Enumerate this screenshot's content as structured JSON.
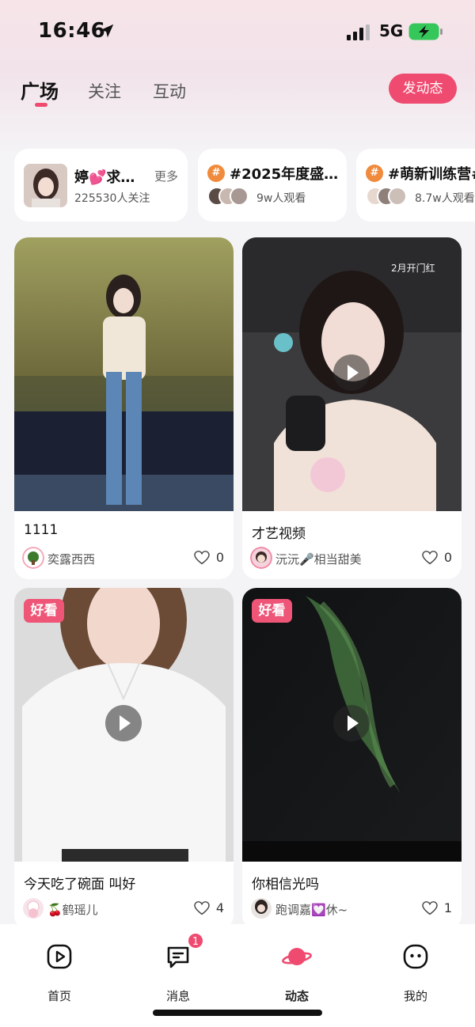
{
  "status_bar": {
    "time": "16:46",
    "network": "5G"
  },
  "header": {
    "tabs": [
      {
        "label": "广场",
        "active": true
      },
      {
        "label": "关注",
        "active": false
      },
      {
        "label": "互动",
        "active": false
      }
    ],
    "post_button": "发动态",
    "accent_color": "#ef4a6f"
  },
  "topics": [
    {
      "type": "user",
      "name": "婷💕求…",
      "more": "更多",
      "followers": "225530人关注"
    },
    {
      "type": "topic",
      "title": "#2025年度盛…",
      "viewers": "9w人观看"
    },
    {
      "type": "topic",
      "title": "#萌新训练营#",
      "viewers": "8.7w人观看"
    }
  ],
  "feed": [
    {
      "title": "1111",
      "user": "奕露西西",
      "likes": "0",
      "badge": "",
      "video": false
    },
    {
      "title": "才艺视频",
      "user": "沅沅🎤相当甜美",
      "likes": "0",
      "badge": "",
      "video": true,
      "overlay": "2月开门红"
    },
    {
      "title": "今天吃了碗面  叫好",
      "user": "🍒鹤瑶儿",
      "likes": "4",
      "badge": "好看",
      "video": true
    },
    {
      "title": "你相信光吗",
      "user": "跑调嘉💟休~",
      "likes": "1",
      "badge": "好看",
      "video": true
    }
  ],
  "bottom_nav": [
    {
      "label": "首页",
      "icon": "play-square-icon"
    },
    {
      "label": "消息",
      "icon": "message-icon",
      "badge": "1"
    },
    {
      "label": "动态",
      "icon": "planet-icon",
      "active": true
    },
    {
      "label": "我的",
      "icon": "smile-face-icon"
    }
  ]
}
